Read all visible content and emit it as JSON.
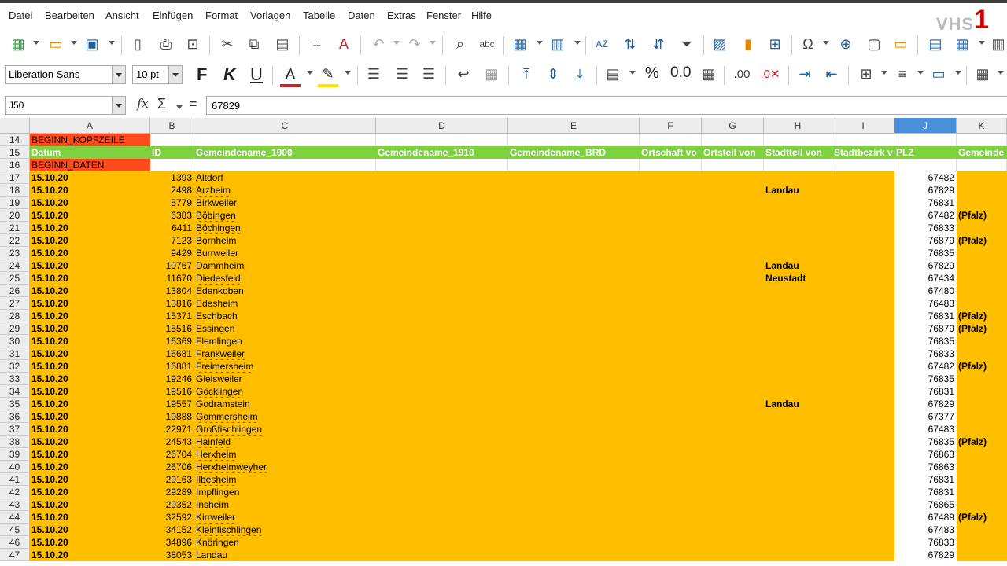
{
  "menu": [
    "Datei",
    "Bearbeiten",
    "Ansicht",
    "Einfügen",
    "Format",
    "Vorlagen",
    "Tabelle",
    "Daten",
    "Extras",
    "Fenster",
    "Hilfe"
  ],
  "logo": {
    "text": "VHS",
    "mark": "1"
  },
  "toolbar2": {
    "font_name": "Liberation Sans",
    "font_size": "10 pt",
    "bold": "F",
    "italic": "K",
    "underline": "U",
    "percent": "%",
    "decimal": "0,0"
  },
  "formula": {
    "name_box": "J50",
    "fx": "fx",
    "sigma": "Σ",
    "equals": "=",
    "value": "67829"
  },
  "columns": [
    "A",
    "B",
    "C",
    "D",
    "E",
    "F",
    "G",
    "H",
    "I",
    "J",
    "K"
  ],
  "accent": {
    "yellow": "#ffbf00",
    "green": "#7fd140",
    "red": "#ff4a1c"
  },
  "rows": [
    {
      "n": "14",
      "a": "BEGINN_KOPFZEILE"
    },
    {
      "n": "15",
      "header": true,
      "a": "Datum",
      "b": "ID",
      "c": "Gemeindename_1900",
      "d": "Gemeindename_1910",
      "e": "Gemeindename_BRD",
      "f": "Ortschaft vo",
      "g": "Ortsteil von",
      "h": "Stadtteil von",
      "i": "Stadtbezirk v",
      "j": "PLZ",
      "k": "Gemeinde"
    },
    {
      "n": "16",
      "a": "BEGINN_DATEN"
    },
    {
      "n": "17",
      "a": "15.10.20",
      "b": "1393",
      "c": "Altdorf",
      "h": "",
      "j": "67482",
      "k": ""
    },
    {
      "n": "18",
      "a": "15.10.20",
      "b": "2498",
      "c": "Arzheim",
      "h": "Landau",
      "j": "67829",
      "k": ""
    },
    {
      "n": "19",
      "a": "15.10.20",
      "b": "5779",
      "c": "Birkweiler",
      "h": "",
      "j": "76831",
      "k": ""
    },
    {
      "n": "20",
      "a": "15.10.20",
      "b": "6383",
      "c": "Böbingen",
      "h": "",
      "j": "67482",
      "k": "(Pfalz)"
    },
    {
      "n": "21",
      "a": "15.10.20",
      "b": "6411",
      "c": "Böchingen",
      "h": "",
      "j": "76833",
      "k": ""
    },
    {
      "n": "22",
      "a": "15.10.20",
      "b": "7123",
      "c": "Bornheim",
      "h": "",
      "j": "76879",
      "k": "(Pfalz)"
    },
    {
      "n": "23",
      "a": "15.10.20",
      "b": "9429",
      "c": "Burrweiler",
      "h": "",
      "j": "76835",
      "k": ""
    },
    {
      "n": "24",
      "a": "15.10.20",
      "b": "10767",
      "c": "Dammheim",
      "h": "Landau",
      "j": "67829",
      "k": ""
    },
    {
      "n": "25",
      "a": "15.10.20",
      "b": "11670",
      "c": "Diedesfeld",
      "h": "Neustadt",
      "j": "67434",
      "k": ""
    },
    {
      "n": "26",
      "a": "15.10.20",
      "b": "13804",
      "c": "Edenkoben",
      "h": "",
      "j": "67480",
      "k": ""
    },
    {
      "n": "27",
      "a": "15.10.20",
      "b": "13816",
      "c": "Edesheim",
      "h": "",
      "j": "76483",
      "k": ""
    },
    {
      "n": "28",
      "a": "15.10.20",
      "b": "15371",
      "c": "Eschbach",
      "h": "",
      "j": "76831",
      "k": "(Pfalz)"
    },
    {
      "n": "29",
      "a": "15.10.20",
      "b": "15516",
      "c": "Essingen",
      "h": "",
      "j": "76879",
      "k": "(Pfalz)"
    },
    {
      "n": "30",
      "a": "15.10.20",
      "b": "16369",
      "c": "Flemlingen",
      "h": "",
      "j": "76835",
      "k": ""
    },
    {
      "n": "31",
      "a": "15.10.20",
      "b": "16681",
      "c": "Frankweiler",
      "h": "",
      "j": "76833",
      "k": ""
    },
    {
      "n": "32",
      "a": "15.10.20",
      "b": "16881",
      "c": "Freimersheim",
      "h": "",
      "j": "67482",
      "k": "(Pfalz)"
    },
    {
      "n": "33",
      "a": "15.10.20",
      "b": "19246",
      "c": "Gleisweiler",
      "h": "",
      "j": "76835",
      "k": ""
    },
    {
      "n": "34",
      "a": "15.10.20",
      "b": "19516",
      "c": "Göcklingen",
      "h": "",
      "j": "76831",
      "k": ""
    },
    {
      "n": "35",
      "a": "15.10.20",
      "b": "19557",
      "c": "Godramstein",
      "h": "Landau",
      "j": "67829",
      "k": ""
    },
    {
      "n": "36",
      "a": "15.10.20",
      "b": "19888",
      "c": "Gommersheim",
      "h": "",
      "j": "67377",
      "k": ""
    },
    {
      "n": "37",
      "a": "15.10.20",
      "b": "22971",
      "c": "Großfischlingen",
      "h": "",
      "j": "67483",
      "k": ""
    },
    {
      "n": "38",
      "a": "15.10.20",
      "b": "24543",
      "c": "Hainfeld",
      "h": "",
      "j": "76835",
      "k": "(Pfalz)"
    },
    {
      "n": "39",
      "a": "15.10.20",
      "b": "26704",
      "c": "Herxheim",
      "h": "",
      "j": "76863",
      "k": ""
    },
    {
      "n": "40",
      "a": "15.10.20",
      "b": "26706",
      "c": "Herxheimweyher",
      "h": "",
      "j": "76863",
      "k": ""
    },
    {
      "n": "41",
      "a": "15.10.20",
      "b": "29163",
      "c": "Ilbesheim",
      "h": "",
      "j": "76831",
      "k": ""
    },
    {
      "n": "42",
      "a": "15.10.20",
      "b": "29289",
      "c": "Impflingen",
      "h": "",
      "j": "76831",
      "k": ""
    },
    {
      "n": "43",
      "a": "15.10.20",
      "b": "29352",
      "c": "Insheim",
      "h": "",
      "j": "76865",
      "k": ""
    },
    {
      "n": "44",
      "a": "15.10.20",
      "b": "32592",
      "c": "Kirrweiler",
      "h": "",
      "j": "67489",
      "k": "(Pfalz)"
    },
    {
      "n": "45",
      "a": "15.10.20",
      "b": "34152",
      "c": "Kleinfischlingen",
      "h": "",
      "j": "67483",
      "k": ""
    },
    {
      "n": "46",
      "a": "15.10.20",
      "b": "34896",
      "c": "Knöringen",
      "h": "",
      "j": "76833",
      "k": ""
    },
    {
      "n": "47",
      "a": "15.10.20",
      "b": "38053",
      "c": "Landau",
      "h": "",
      "j": "67829",
      "k": ""
    }
  ]
}
